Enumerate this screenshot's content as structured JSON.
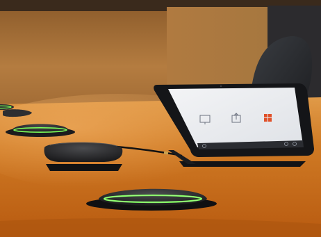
{
  "scene": {
    "tablet": {
      "title": "",
      "tiles": [
        {
          "icon": "display-icon",
          "label": ""
        },
        {
          "icon": "share-icon",
          "label": ""
        },
        {
          "icon": "windows-logo-icon",
          "label": ""
        }
      ],
      "brand": ""
    },
    "colors": {
      "wall": "#b07a3e",
      "table": "#c9701e",
      "table_highlight": "#e8a050",
      "speaker_ring": "#7dff5a",
      "device_dark": "#2a2a2c"
    }
  }
}
